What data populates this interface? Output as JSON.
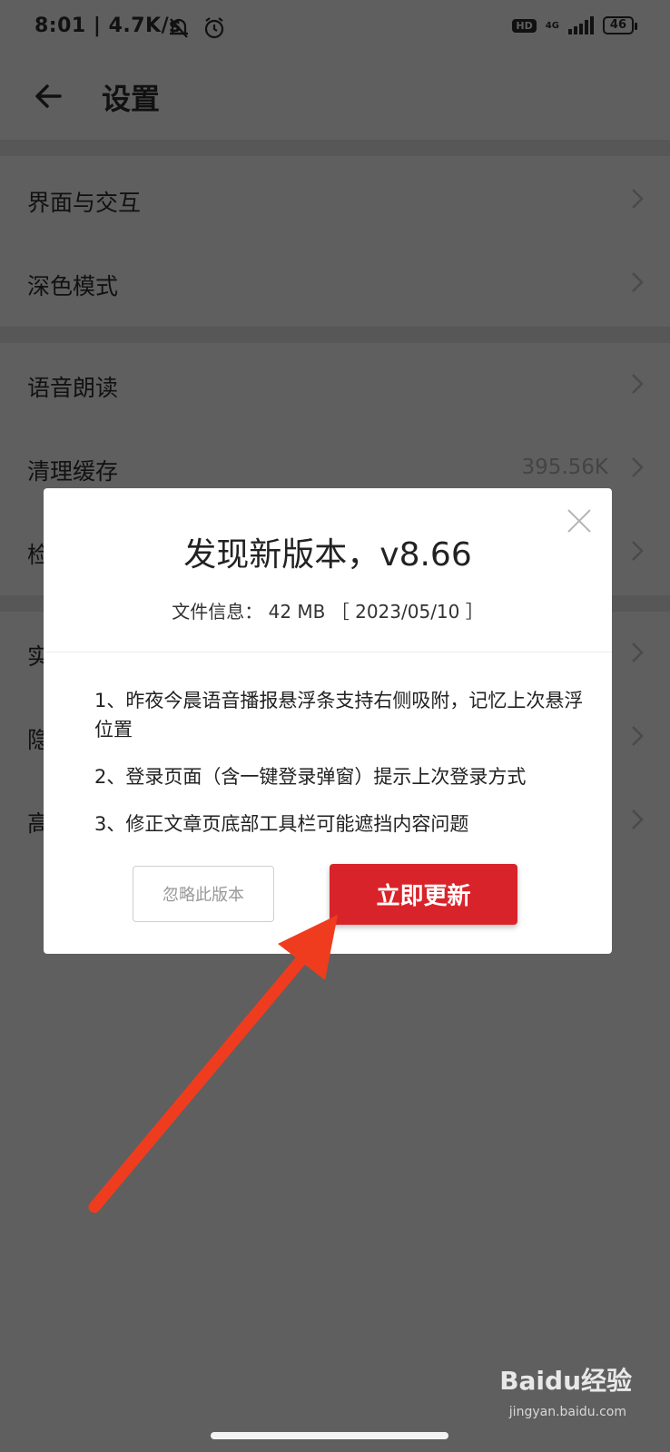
{
  "status_bar": {
    "time": "8:01 | 4.7K/s",
    "hd": "HD",
    "network": "4G",
    "battery": "46"
  },
  "header": {
    "title": "设置"
  },
  "settings": {
    "items": [
      {
        "label": "界面与交互",
        "value": ""
      },
      {
        "label": "深色模式",
        "value": ""
      },
      {
        "label": "语音朗读",
        "value": ""
      },
      {
        "label": "清理缓存",
        "value": "395.56K"
      },
      {
        "label": "检",
        "value": ""
      },
      {
        "label": "实",
        "value": ""
      },
      {
        "label": "隐",
        "value": ""
      },
      {
        "label": "高",
        "value": ""
      }
    ]
  },
  "dialog": {
    "title": "发现新版本，v8.66",
    "file_info": "文件信息： 42 MB ［ 2023/05/10 ］",
    "notes": [
      "1、昨夜今晨语音播报悬浮条支持右侧吸附，记忆上次悬浮位置",
      "2、登录页面（含一键登录弹窗）提示上次登录方式",
      "3、修正文章页底部工具栏可能遮挡内容问题"
    ],
    "ignore_label": "忽略此版本",
    "update_label": "立即更新"
  },
  "watermark": {
    "brand": "Baidu经验",
    "url": "jingyan.baidu.com"
  },
  "colors": {
    "overlay": "#5f5f5f",
    "accent": "#d9232a",
    "arrow": "#f03c1e"
  }
}
